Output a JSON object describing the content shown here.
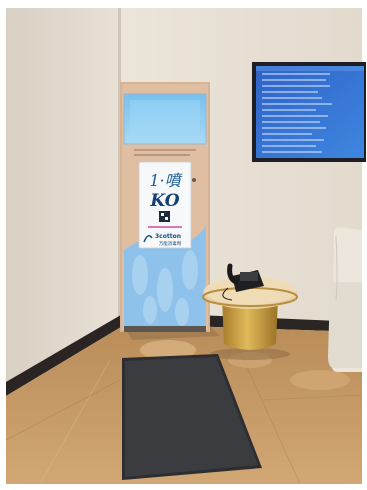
{
  "scene": {
    "kiosk": {
      "poster_line1": "1·噴",
      "poster_line2": "KO",
      "brand_name": "3cotton",
      "brand_tagline": "万能消毒劑"
    },
    "tv": {
      "list_lines": 15
    },
    "colors": {
      "wall": "#e6ddd2",
      "floor": "#c79a63",
      "kiosk_frame": "#dcbb9f",
      "kiosk_blue": "#8fc2ea",
      "tv_screen": "#2f6fd0",
      "mat": "#3b3b3d",
      "table_gold": "#c9a04a",
      "armchair": "#efe9e0"
    }
  }
}
